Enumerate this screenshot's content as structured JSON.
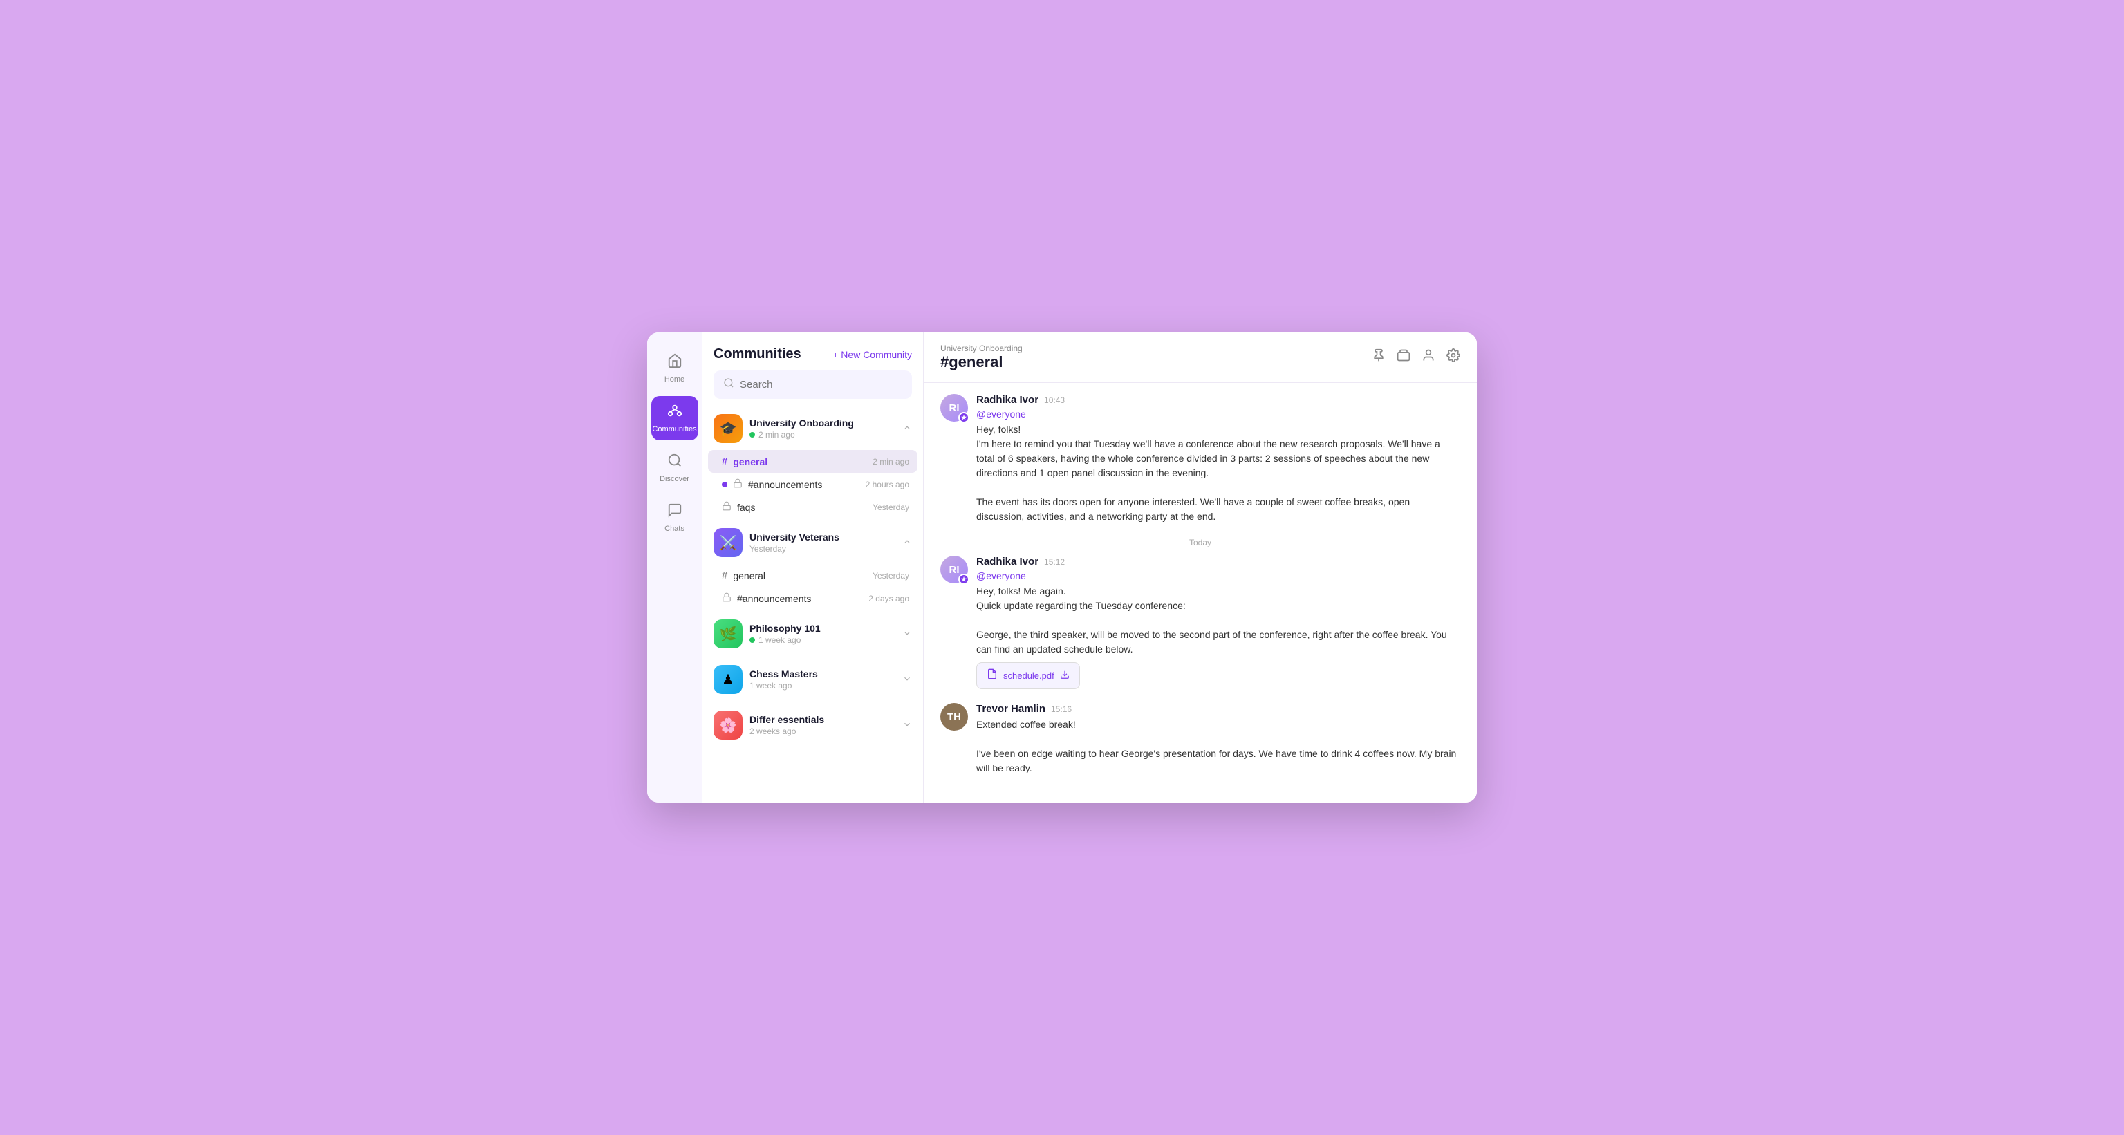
{
  "nav": {
    "home_label": "Home",
    "communities_label": "Communities",
    "discover_label": "Discover",
    "chats_label": "Chats"
  },
  "communities_panel": {
    "title": "Communities",
    "new_community_label": "+ New Community",
    "search_placeholder": "Search",
    "communities": [
      {
        "id": "university-onboarding",
        "name": "University Onboarding",
        "time": "2 min ago",
        "online": true,
        "expanded": true,
        "channels": [
          {
            "name": "#general",
            "time": "2 min ago",
            "active": true,
            "unread": false
          },
          {
            "name": "#announcements",
            "time": "2 hours ago",
            "active": false,
            "unread": true,
            "locked": true
          },
          {
            "name": "faqs",
            "time": "Yesterday",
            "active": false,
            "unread": false,
            "locked": true
          }
        ]
      },
      {
        "id": "university-veterans",
        "name": "University Veterans",
        "time": "Yesterday",
        "online": false,
        "expanded": true,
        "channels": [
          {
            "name": "#general",
            "time": "Yesterday",
            "active": false,
            "unread": false
          },
          {
            "name": "#announcements",
            "time": "2 days ago",
            "active": false,
            "unread": false,
            "locked": true
          }
        ]
      },
      {
        "id": "philosophy-101",
        "name": "Philosophy 101",
        "time": "1 week ago",
        "online": true,
        "expanded": false,
        "channels": []
      },
      {
        "id": "chess-masters",
        "name": "Chess Masters",
        "time": "1 week ago",
        "online": false,
        "expanded": false,
        "channels": []
      },
      {
        "id": "differ-essentials",
        "name": "Differ essentials",
        "time": "2 weeks ago",
        "online": false,
        "expanded": false,
        "channels": []
      }
    ]
  },
  "chat": {
    "community_name": "University Onboarding",
    "channel_name": "#general",
    "messages": [
      {
        "id": 1,
        "author": "Radhika Ivor",
        "time": "10:43",
        "badge": true,
        "mention": "@everyone",
        "lines": [
          "Hey, folks!",
          "I'm here to remind you that Tuesday we'll have a conference about the new research proposals. We'll have a total of 6 speakers, having the whole conference divided in 3 parts: 2 sessions of speeches about the new directions and 1 open panel discussion in the evening.",
          "The event has its doors open for anyone interested. We'll have a couple of sweet coffee breaks, open discussion, activities, and a networking party at the end."
        ],
        "divider_before": false
      },
      {
        "id": 2,
        "author": "Radhika Ivor",
        "time": "15:12",
        "badge": true,
        "mention": "@everyone",
        "divider_before": true,
        "divider_label": "Today",
        "lines": [
          "Hey, folks! Me again.",
          "Quick update regarding the Tuesday conference:",
          "George, the third speaker, will be moved to the second part of the conference, right after the coffee break. You can find an updated schedule below."
        ],
        "attachment": {
          "name": "schedule.pdf",
          "icon": "📄"
        }
      },
      {
        "id": 3,
        "author": "Trevor Hamlin",
        "time": "15:16",
        "badge": false,
        "mention": null,
        "divider_before": false,
        "lines": [
          "Extended coffee break!",
          "I've been on edge waiting to hear George's presentation for days. We have time to drink 4 coffees now. My brain will be ready."
        ]
      }
    ]
  },
  "icons": {
    "home": "⌂",
    "communities": "⬡",
    "discover": "⊕",
    "chats": "💬",
    "search": "🔍",
    "pin": "📌",
    "layers": "⧉",
    "person": "👤",
    "settings": "⚙",
    "chevron_up": "∧",
    "chevron_down": "∨",
    "lock": "🔒",
    "file": "📄",
    "download": "⬇"
  }
}
